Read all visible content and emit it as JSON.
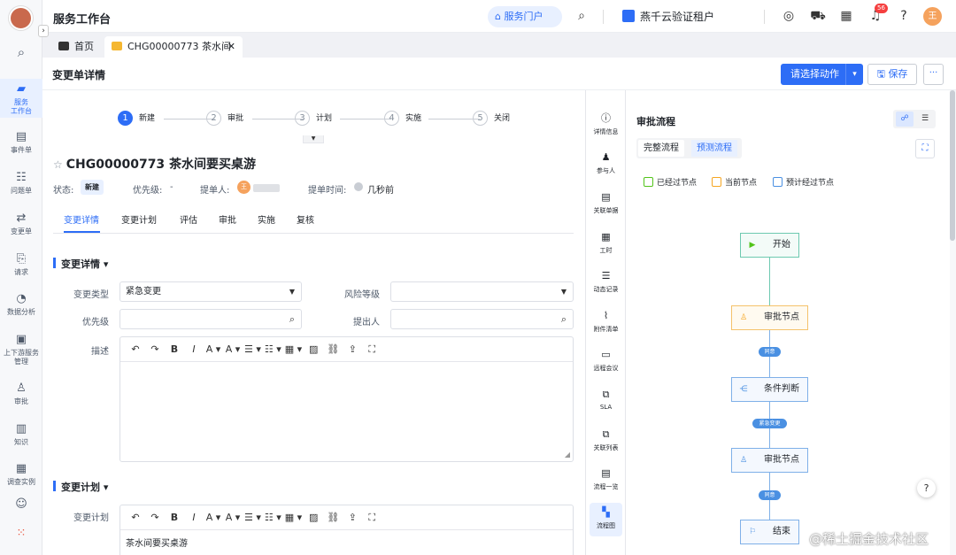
{
  "app": {
    "title": "服务工作台"
  },
  "header": {
    "portal_label": "服务门户",
    "tenant": "燕千云验证租户",
    "notification_count": "56",
    "avatar_initial": "王"
  },
  "sidebar": {
    "items": [
      {
        "label": "服务\n工作台",
        "icon": "briefcase-icon"
      },
      {
        "label": "事件单",
        "icon": "doc-icon"
      },
      {
        "label": "问题单",
        "icon": "list-icon"
      },
      {
        "label": "变更单",
        "icon": "change-icon"
      },
      {
        "label": "请求",
        "icon": "request-icon"
      },
      {
        "label": "数据分析",
        "icon": "chart-icon"
      },
      {
        "label": "上下游服务管理",
        "icon": "service-icon"
      },
      {
        "label": "审批",
        "icon": "approve-icon"
      },
      {
        "label": "知识",
        "icon": "book-icon"
      },
      {
        "label": "调查实例",
        "icon": "grid-icon"
      }
    ]
  },
  "tabs": [
    {
      "label": "首页"
    },
    {
      "label": "CHG00000773 茶水间"
    }
  ],
  "page": {
    "title": "变更单详情",
    "action_label": "请选择动作",
    "save_label": "保存"
  },
  "steps": [
    {
      "num": "1",
      "label": "新建"
    },
    {
      "num": "2",
      "label": "审批"
    },
    {
      "num": "3",
      "label": "计划"
    },
    {
      "num": "4",
      "label": "实施"
    },
    {
      "num": "5",
      "label": "关闭"
    }
  ],
  "ticket": {
    "title": "CHG00000773  茶水间要买桌游",
    "status_label": "状态:",
    "status": "新建",
    "priority_label": "优先级:",
    "priority": "-",
    "submitter_label": "提单人:",
    "submitter_initial": "王",
    "submit_time_label": "提单时间:",
    "submit_time": "几秒前"
  },
  "subtabs": [
    "变更详情",
    "变更计划",
    "评估",
    "审批",
    "实施",
    "复核"
  ],
  "detail": {
    "section_title": "变更详情",
    "change_type_label": "变更类型",
    "change_type": "紧急变更",
    "risk_label": "风险等级",
    "priority_label": "优先级",
    "submitter_label": "提出人",
    "desc_label": "描述"
  },
  "plan": {
    "section_title": "变更计划",
    "plan_label": "变更计划",
    "plan_content": "茶水间要买桌游"
  },
  "toolbar": {
    "items": [
      "↶",
      "↷",
      "B",
      "I",
      "A ▾",
      "A ▾",
      "☰ ▾",
      "☷ ▾",
      "▦ ▾",
      "▨",
      "⛓",
      "⇪",
      "⛶"
    ]
  },
  "rail": {
    "items": [
      {
        "label": "详情信息",
        "icon": "info-icon"
      },
      {
        "label": "参与人",
        "icon": "people-icon"
      },
      {
        "label": "关联单据",
        "icon": "link-doc-icon"
      },
      {
        "label": "工时",
        "icon": "calendar-icon"
      },
      {
        "label": "动态记录",
        "icon": "record-icon"
      },
      {
        "label": "附件清单",
        "icon": "attach-icon"
      },
      {
        "label": "远程会议",
        "icon": "monitor-icon"
      },
      {
        "label": "SLA",
        "icon": "sla-icon"
      },
      {
        "label": "关联列表",
        "icon": "list-link-icon"
      },
      {
        "label": "流程一览",
        "icon": "flow-list-icon"
      },
      {
        "label": "流程图",
        "icon": "flowchart-icon"
      }
    ]
  },
  "flow": {
    "title": "审批流程",
    "tab_full": "完整流程",
    "tab_predict": "预测流程",
    "legend_passed": "已经过节点",
    "legend_current": "当前节点",
    "legend_expected": "预计经过节点",
    "nodes": [
      "开始",
      "审批节点",
      "条件判断",
      "审批节点",
      "结束"
    ],
    "edges": [
      "同意",
      "紧急变更",
      "同意"
    ],
    "colors": {
      "passed": "#52c41a",
      "current": "#f5a623",
      "expected": "#4a90e2"
    }
  },
  "watermark": "@稀土掘金技术社区"
}
